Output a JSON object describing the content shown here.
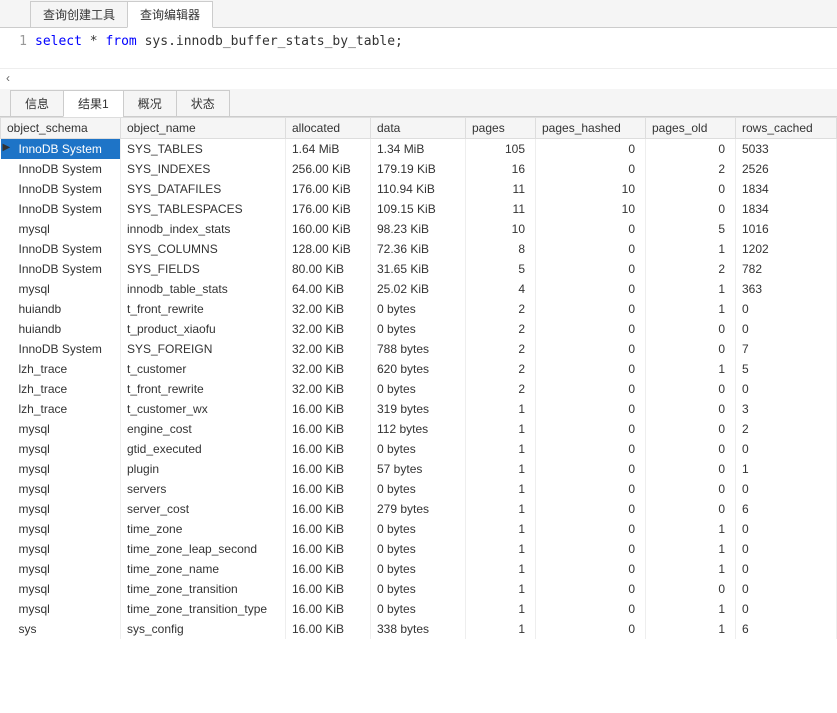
{
  "topTabs": {
    "builder": "查询创建工具",
    "editor": "查询编辑器"
  },
  "sql": {
    "lineNum": "1",
    "kw1": "select",
    "mid": " * ",
    "kw2": "from",
    "rest": " sys.innodb_buffer_stats_by_table;"
  },
  "arrows": "‹",
  "resultTabs": {
    "info": "信息",
    "result1": "结果1",
    "profile": "概况",
    "status": "状态"
  },
  "headers": {
    "object_schema": "object_schema",
    "object_name": "object_name",
    "allocated": "allocated",
    "data": "data",
    "pages": "pages",
    "pages_hashed": "pages_hashed",
    "pages_old": "pages_old",
    "rows_cached": "rows_cached"
  },
  "rows": [
    {
      "schema": "InnoDB System",
      "name": "SYS_TABLES",
      "alloc": "1.64 MiB",
      "data": "1.34 MiB",
      "pages": "105",
      "hashed": "0",
      "old": "0",
      "cached": "5033",
      "sel": true
    },
    {
      "schema": "InnoDB System",
      "name": "SYS_INDEXES",
      "alloc": "256.00 KiB",
      "data": "179.19 KiB",
      "pages": "16",
      "hashed": "0",
      "old": "2",
      "cached": "2526"
    },
    {
      "schema": "InnoDB System",
      "name": "SYS_DATAFILES",
      "alloc": "176.00 KiB",
      "data": "110.94 KiB",
      "pages": "11",
      "hashed": "10",
      "old": "0",
      "cached": "1834"
    },
    {
      "schema": "InnoDB System",
      "name": "SYS_TABLESPACES",
      "alloc": "176.00 KiB",
      "data": "109.15 KiB",
      "pages": "11",
      "hashed": "10",
      "old": "0",
      "cached": "1834"
    },
    {
      "schema": "mysql",
      "name": "innodb_index_stats",
      "alloc": "160.00 KiB",
      "data": "98.23 KiB",
      "pages": "10",
      "hashed": "0",
      "old": "5",
      "cached": "1016"
    },
    {
      "schema": "InnoDB System",
      "name": "SYS_COLUMNS",
      "alloc": "128.00 KiB",
      "data": "72.36 KiB",
      "pages": "8",
      "hashed": "0",
      "old": "1",
      "cached": "1202"
    },
    {
      "schema": "InnoDB System",
      "name": "SYS_FIELDS",
      "alloc": "80.00 KiB",
      "data": "31.65 KiB",
      "pages": "5",
      "hashed": "0",
      "old": "2",
      "cached": "782"
    },
    {
      "schema": "mysql",
      "name": "innodb_table_stats",
      "alloc": "64.00 KiB",
      "data": "25.02 KiB",
      "pages": "4",
      "hashed": "0",
      "old": "1",
      "cached": "363"
    },
    {
      "schema": "huiandb",
      "name": "t_front_rewrite",
      "alloc": "32.00 KiB",
      "data": "0 bytes",
      "pages": "2",
      "hashed": "0",
      "old": "1",
      "cached": "0"
    },
    {
      "schema": "huiandb",
      "name": "t_product_xiaofu",
      "alloc": "32.00 KiB",
      "data": "0 bytes",
      "pages": "2",
      "hashed": "0",
      "old": "0",
      "cached": "0"
    },
    {
      "schema": "InnoDB System",
      "name": "SYS_FOREIGN",
      "alloc": "32.00 KiB",
      "data": "788 bytes",
      "pages": "2",
      "hashed": "0",
      "old": "0",
      "cached": "7"
    },
    {
      "schema": "lzh_trace",
      "name": "t_customer",
      "alloc": "32.00 KiB",
      "data": "620 bytes",
      "pages": "2",
      "hashed": "0",
      "old": "1",
      "cached": "5"
    },
    {
      "schema": "lzh_trace",
      "name": "t_front_rewrite",
      "alloc": "32.00 KiB",
      "data": "0 bytes",
      "pages": "2",
      "hashed": "0",
      "old": "0",
      "cached": "0"
    },
    {
      "schema": "lzh_trace",
      "name": "t_customer_wx",
      "alloc": "16.00 KiB",
      "data": "319 bytes",
      "pages": "1",
      "hashed": "0",
      "old": "0",
      "cached": "3"
    },
    {
      "schema": "mysql",
      "name": "engine_cost",
      "alloc": "16.00 KiB",
      "data": "112 bytes",
      "pages": "1",
      "hashed": "0",
      "old": "0",
      "cached": "2"
    },
    {
      "schema": "mysql",
      "name": "gtid_executed",
      "alloc": "16.00 KiB",
      "data": "0 bytes",
      "pages": "1",
      "hashed": "0",
      "old": "0",
      "cached": "0"
    },
    {
      "schema": "mysql",
      "name": "plugin",
      "alloc": "16.00 KiB",
      "data": "57 bytes",
      "pages": "1",
      "hashed": "0",
      "old": "0",
      "cached": "1"
    },
    {
      "schema": "mysql",
      "name": "servers",
      "alloc": "16.00 KiB",
      "data": "0 bytes",
      "pages": "1",
      "hashed": "0",
      "old": "0",
      "cached": "0"
    },
    {
      "schema": "mysql",
      "name": "server_cost",
      "alloc": "16.00 KiB",
      "data": "279 bytes",
      "pages": "1",
      "hashed": "0",
      "old": "0",
      "cached": "6"
    },
    {
      "schema": "mysql",
      "name": "time_zone",
      "alloc": "16.00 KiB",
      "data": "0 bytes",
      "pages": "1",
      "hashed": "0",
      "old": "1",
      "cached": "0"
    },
    {
      "schema": "mysql",
      "name": "time_zone_leap_second",
      "alloc": "16.00 KiB",
      "data": "0 bytes",
      "pages": "1",
      "hashed": "0",
      "old": "1",
      "cached": "0"
    },
    {
      "schema": "mysql",
      "name": "time_zone_name",
      "alloc": "16.00 KiB",
      "data": "0 bytes",
      "pages": "1",
      "hashed": "0",
      "old": "1",
      "cached": "0"
    },
    {
      "schema": "mysql",
      "name": "time_zone_transition",
      "alloc": "16.00 KiB",
      "data": "0 bytes",
      "pages": "1",
      "hashed": "0",
      "old": "0",
      "cached": "0"
    },
    {
      "schema": "mysql",
      "name": "time_zone_transition_type",
      "alloc": "16.00 KiB",
      "data": "0 bytes",
      "pages": "1",
      "hashed": "0",
      "old": "1",
      "cached": "0"
    },
    {
      "schema": "sys",
      "name": "sys_config",
      "alloc": "16.00 KiB",
      "data": "338 bytes",
      "pages": "1",
      "hashed": "0",
      "old": "1",
      "cached": "6"
    }
  ]
}
